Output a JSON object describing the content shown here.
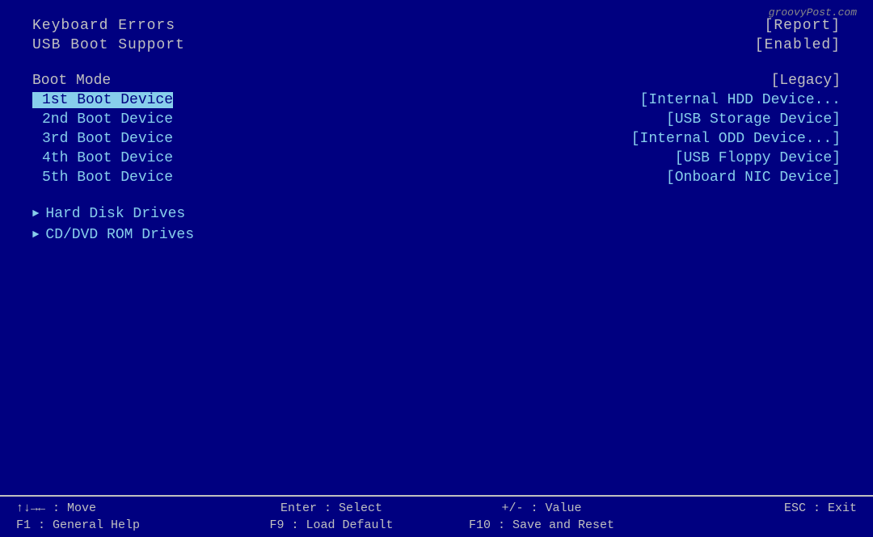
{
  "watermark": "groovyPost.com",
  "top_settings": [
    {
      "label": "Keyboard Errors",
      "value": "[Report]"
    },
    {
      "label": "USB Boot Support",
      "value": "[Enabled]"
    }
  ],
  "section_gap": true,
  "boot_mode": {
    "label": "Boot Mode",
    "value": "[Legacy]"
  },
  "boot_devices": [
    {
      "label": "1st Boot Device",
      "value": "[Internal HDD Device...",
      "selected": true
    },
    {
      "label": "2nd Boot Device",
      "value": "[USB Storage Device]",
      "selected": false
    },
    {
      "label": "3rd Boot Device",
      "value": "[Internal ODD Device...]",
      "selected": false
    },
    {
      "label": "4th Boot Device",
      "value": "[USB Floppy Device]",
      "selected": false
    },
    {
      "label": "5th Boot Device",
      "value": "[Onboard NIC Device]",
      "selected": false
    }
  ],
  "sub_menus": [
    {
      "label": "Hard Disk Drives"
    },
    {
      "label": "CD/DVD ROM Drives"
    }
  ],
  "bottom_bar": {
    "line1": [
      {
        "key": "↑↓→←",
        "desc": ": Move"
      },
      {
        "key": "Enter",
        "desc": ": Select"
      },
      {
        "key": "+/-",
        "desc": ": Value"
      },
      {
        "key": "ESC",
        "desc": ": Exit"
      }
    ],
    "line2": [
      {
        "key": "F1",
        "desc": ": General Help"
      },
      {
        "key": "F9",
        "desc": ": Load Default"
      },
      {
        "key": "F10",
        "desc": ": Save and Reset"
      }
    ]
  }
}
